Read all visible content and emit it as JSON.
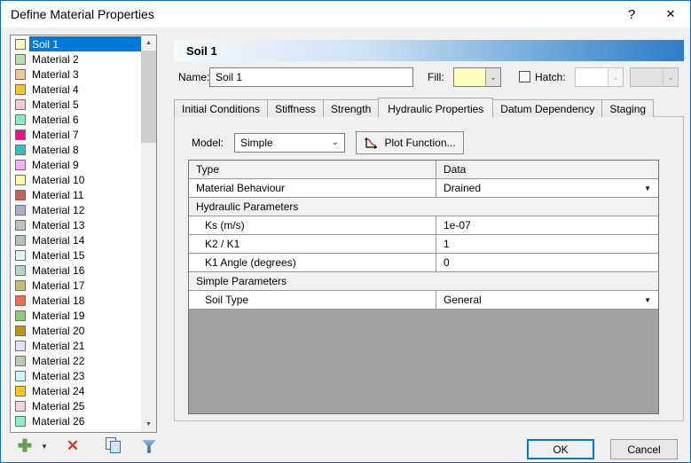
{
  "window": {
    "title": "Define Material Properties",
    "help_glyph": "?",
    "close_glyph": "✕"
  },
  "colors": {
    "selection": "#0078D7",
    "fill_swatch": "#FFFFC2",
    "table_filler": "#A2A2A2",
    "header_gradient_end": "#2E7CC6"
  },
  "materials": {
    "selected_index": 0,
    "items": [
      {
        "name": "Soil 1",
        "color": "#FFFFC2"
      },
      {
        "name": "Material 2",
        "color": "#BCDBAE"
      },
      {
        "name": "Material 3",
        "color": "#F6C795"
      },
      {
        "name": "Material 4",
        "color": "#FFC125"
      },
      {
        "name": "Material 5",
        "color": "#F8C8CF"
      },
      {
        "name": "Material 6",
        "color": "#86EFC3"
      },
      {
        "name": "Material 7",
        "color": "#EE1289"
      },
      {
        "name": "Material 8",
        "color": "#2FC2BC"
      },
      {
        "name": "Material 9",
        "color": "#F9ACF9"
      },
      {
        "name": "Material 10",
        "color": "#FFFC99"
      },
      {
        "name": "Material 11",
        "color": "#CB5E52"
      },
      {
        "name": "Material 12",
        "color": "#AEAECB"
      },
      {
        "name": "Material 13",
        "color": "#BFBFBF"
      },
      {
        "name": "Material 14",
        "color": "#B1C3B1"
      },
      {
        "name": "Material 15",
        "color": "#DBFBF6"
      },
      {
        "name": "Material 16",
        "color": "#AFD6CB"
      },
      {
        "name": "Material 17",
        "color": "#C0BE72"
      },
      {
        "name": "Material 18",
        "color": "#F96B4E"
      },
      {
        "name": "Material 19",
        "color": "#8FC878"
      },
      {
        "name": "Material 20",
        "color": "#C6930F"
      },
      {
        "name": "Material 21",
        "color": "#E4E4F7"
      },
      {
        "name": "Material 22",
        "color": "#B9CCAF"
      },
      {
        "name": "Material 23",
        "color": "#CDF8FB"
      },
      {
        "name": "Material 24",
        "color": "#FFC517"
      },
      {
        "name": "Material 25",
        "color": "#F9D3DB"
      },
      {
        "name": "Material 26",
        "color": "#8BF2C3"
      }
    ]
  },
  "list_toolbar": {
    "add_icon": "add-material",
    "add_caret": "▾",
    "delete_icon": "delete-material",
    "copy_icon": "copy-material",
    "filter_icon": "filter-materials",
    "add_glyph": "✚",
    "delete_glyph": "✕"
  },
  "panel": {
    "header": "Soil 1",
    "name_label": "Name:",
    "name_value": "Soil 1",
    "fill_label": "Fill:",
    "hatch_label": "Hatch:",
    "hatch_checked": false,
    "tabs": [
      "Initial Conditions",
      "Stiffness",
      "Strength",
      "Hydraulic Properties",
      "Datum Dependency",
      "Staging"
    ],
    "active_tab": 3,
    "model_label": "Model:",
    "model_value": "Simple",
    "plot_button_label": "Plot Function...",
    "table": {
      "columns": [
        "Type",
        "Data"
      ],
      "rows": [
        {
          "kind": "row",
          "label": "Material Behaviour",
          "value": "Drained",
          "dropdown": true,
          "indent": false
        },
        {
          "kind": "section",
          "label": "Hydraulic Parameters"
        },
        {
          "kind": "row",
          "label": "Ks (m/s)",
          "value": "1e-07",
          "dropdown": false,
          "indent": true
        },
        {
          "kind": "row",
          "label": "K2 / K1",
          "value": "1",
          "dropdown": false,
          "indent": true
        },
        {
          "kind": "row",
          "label": "K1 Angle (degrees)",
          "value": "0",
          "dropdown": false,
          "indent": true
        },
        {
          "kind": "section",
          "label": "Simple Parameters"
        },
        {
          "kind": "row",
          "label": "Soil Type",
          "value": "General",
          "dropdown": true,
          "indent": true
        }
      ]
    }
  },
  "footer": {
    "ok_label": "OK",
    "cancel_label": "Cancel"
  }
}
